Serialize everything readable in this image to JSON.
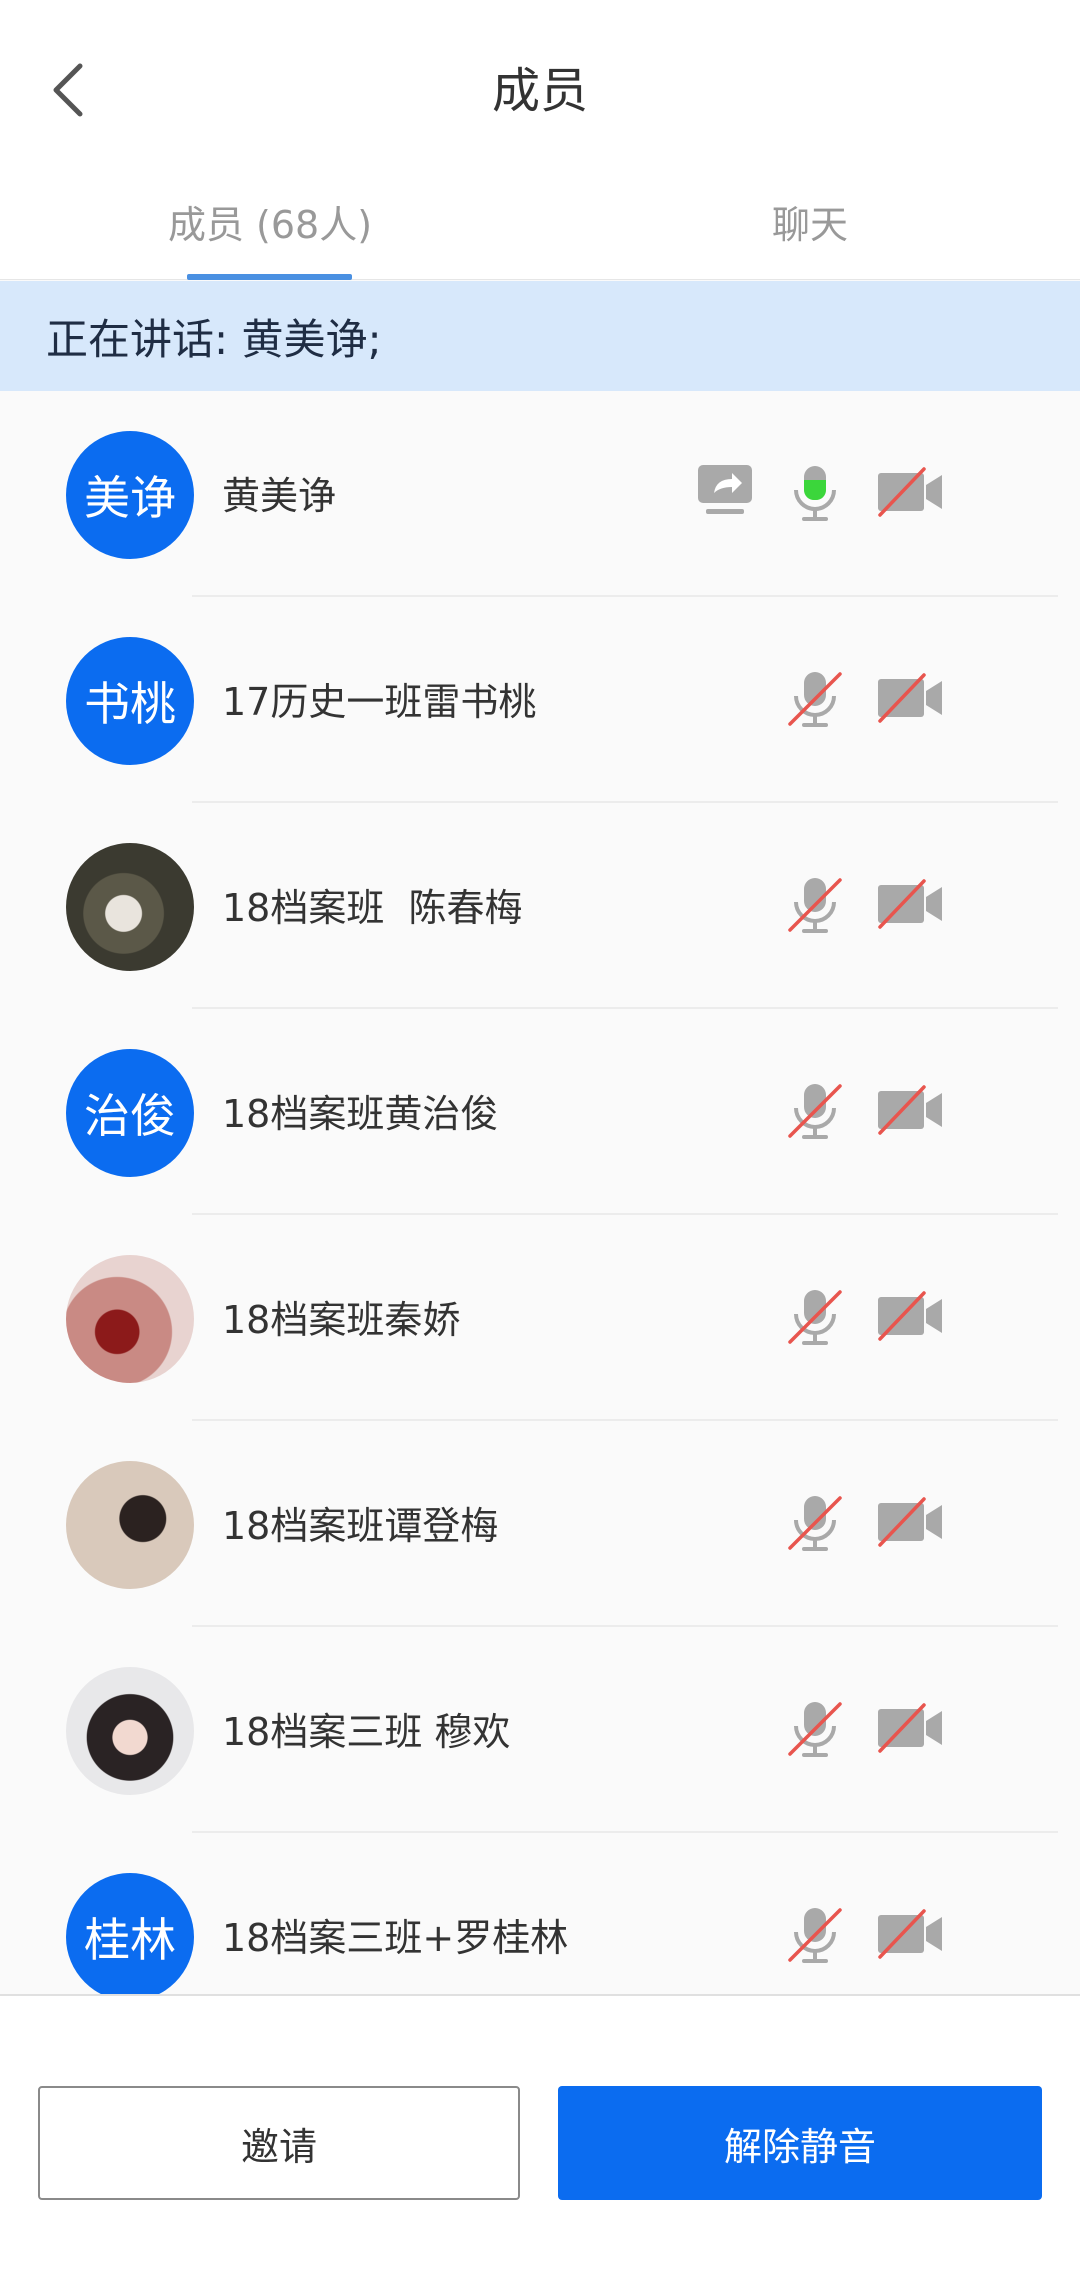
{
  "header": {
    "title": "成员",
    "back_icon": "back-arrow-icon"
  },
  "tabs": [
    {
      "label": "成员 (68人)",
      "active": true
    },
    {
      "label": "聊天",
      "active": false
    }
  ],
  "speaking": {
    "text": "正在讲话: 黄美诤;"
  },
  "members": [
    {
      "name": "黄美诤",
      "avatar_text": "美诤",
      "avatar_type": "text",
      "sharing": true,
      "mic": "active",
      "camera": "off"
    },
    {
      "name": "17历史一班雷书桃",
      "avatar_text": "书桃",
      "avatar_type": "text",
      "sharing": false,
      "mic": "muted",
      "camera": "off"
    },
    {
      "name": "18档案班  陈春梅",
      "avatar_text": "",
      "avatar_type": "photo1",
      "sharing": false,
      "mic": "muted",
      "camera": "off"
    },
    {
      "name": "18档案班黄治俊",
      "avatar_text": "治俊",
      "avatar_type": "text",
      "sharing": false,
      "mic": "muted",
      "camera": "off"
    },
    {
      "name": "18档案班秦娇",
      "avatar_text": "",
      "avatar_type": "photo2",
      "sharing": false,
      "mic": "muted",
      "camera": "off"
    },
    {
      "name": "18档案班谭登梅",
      "avatar_text": "",
      "avatar_type": "photo3",
      "sharing": false,
      "mic": "muted",
      "camera": "off"
    },
    {
      "name": "18档案三班 穆欢",
      "avatar_text": "",
      "avatar_type": "photo4",
      "sharing": false,
      "mic": "muted",
      "camera": "off"
    },
    {
      "name": "18档案三班+罗桂林",
      "avatar_text": "桂林",
      "avatar_type": "text",
      "sharing": false,
      "mic": "muted",
      "camera": "off"
    }
  ],
  "footer": {
    "invite_label": "邀请",
    "unmute_label": "解除静音"
  },
  "colors": {
    "accent": "#0b6cf0",
    "banner": "#d7e8fb",
    "mic_active": "#3bd63b",
    "muted_strike": "#e8554e"
  }
}
